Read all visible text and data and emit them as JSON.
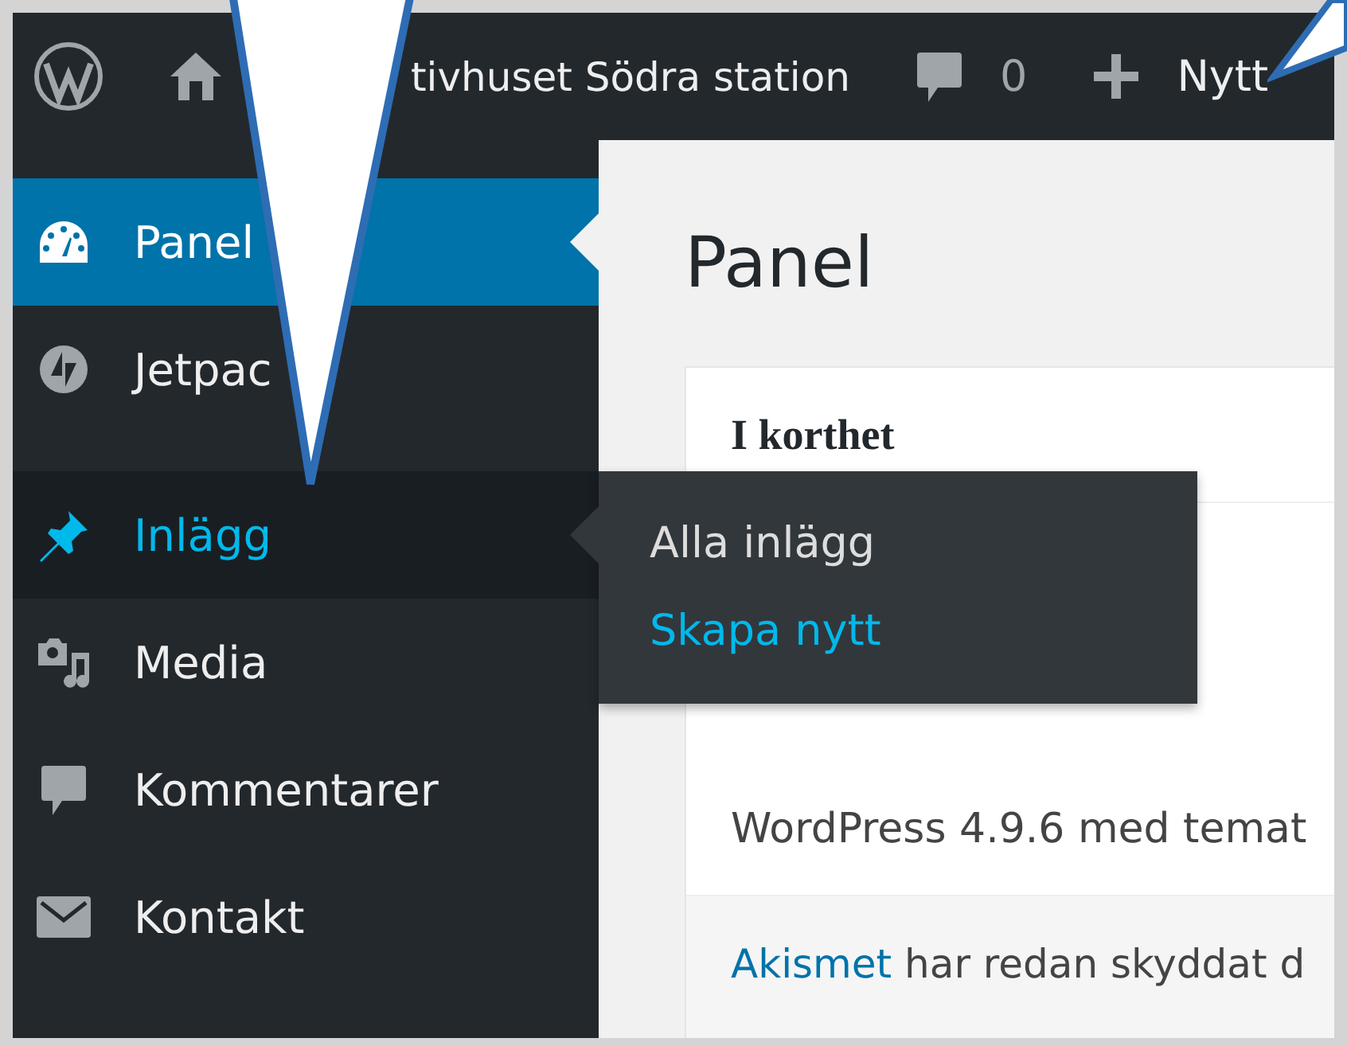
{
  "admin_bar": {
    "site_name": "tivhuset Södra station",
    "comments_count": "0",
    "new_label": "Nytt"
  },
  "sidebar": {
    "items": [
      {
        "label": "Panel",
        "selected": true,
        "hovered": false
      },
      {
        "label": "Jetpac",
        "selected": false,
        "hovered": false
      },
      {
        "label": "Inlägg",
        "selected": false,
        "hovered": true,
        "submenu": [
          {
            "label": "Alla inlägg",
            "hovered": false
          },
          {
            "label": "Skapa nytt",
            "hovered": true
          }
        ]
      },
      {
        "label": "Media",
        "selected": false,
        "hovered": false
      },
      {
        "label": "Kommentarer",
        "selected": false,
        "hovered": false
      },
      {
        "label": "Kontakt",
        "selected": false,
        "hovered": false
      }
    ]
  },
  "page_title": "Panel",
  "card": {
    "title": "I korthet",
    "version_text": "WordPress 4.9.6 med temat",
    "akismet": {
      "link": "Akismet",
      "text": "har redan skyddat d"
    }
  }
}
